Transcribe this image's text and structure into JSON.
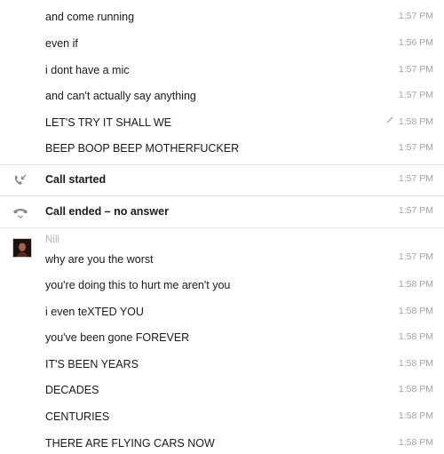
{
  "messages_top": [
    {
      "text": "and come running",
      "time": "1:57 PM"
    },
    {
      "text": "even if",
      "time": "1:56 PM"
    },
    {
      "text": "i dont have a mic",
      "time": "1:57 PM"
    },
    {
      "text": "and can't actually say anything",
      "time": "1:57 PM"
    },
    {
      "text": "LET'S TRY IT SHALL WE",
      "time": "1:58 PM",
      "status_icon": "sent-check-icon"
    },
    {
      "text": "BEEP BOOP BEEP MOTHERFUCKER",
      "time": "1:57 PM"
    }
  ],
  "calls": [
    {
      "text": "Call started",
      "time": "1:57 PM",
      "icon": "call-incoming-icon"
    },
    {
      "text": "Call ended – no answer",
      "time": "1:57 PM",
      "icon": "call-ended-icon"
    }
  ],
  "nili": {
    "sender": "Nili",
    "messages": [
      {
        "text": "why are you the worst",
        "time": "1:57 PM"
      },
      {
        "text": "you're doing this to hurt me aren't you",
        "time": "1:58 PM"
      },
      {
        "text": "i even teXTED YOU",
        "time": "1:58 PM"
      },
      {
        "text": "you've been gone FOREVER",
        "time": "1:58 PM"
      },
      {
        "text": "IT'S BEEN YEARS",
        "time": "1:58 PM"
      },
      {
        "text": "DECADES",
        "time": "1:58 PM"
      },
      {
        "text": "CENTURIES",
        "time": "1:58 PM"
      },
      {
        "text": "THERE ARE FLYING CARS NOW",
        "time": "1:58 PM"
      }
    ]
  },
  "colors": {
    "timestamp": "#a3a3a3",
    "separator": "#e3e3e3",
    "sender": "#b3b3b3",
    "icon": "#8a8a8a"
  }
}
